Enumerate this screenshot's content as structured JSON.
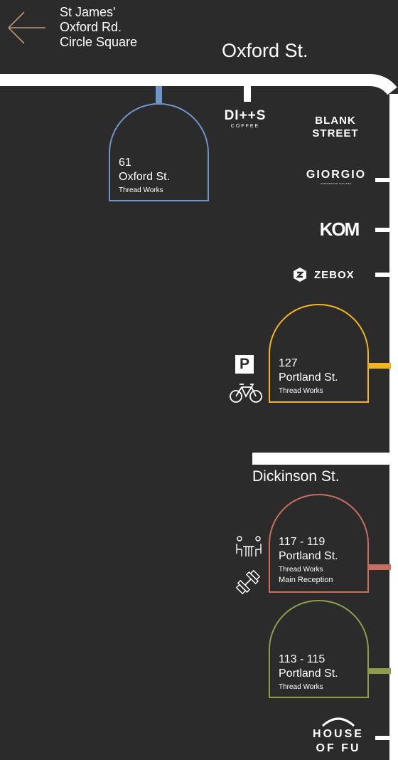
{
  "nav": {
    "back_icon": "arrow-left-icon",
    "destinations": [
      "St James'",
      "Oxford Rd.",
      "Circle Square"
    ]
  },
  "streets": {
    "oxford": "Oxford St.",
    "dickinson": "Dickinson St."
  },
  "buildings": [
    {
      "number": "61",
      "street": "Oxford St.",
      "name": "Thread Works",
      "extra": "",
      "color": "#6f95c8"
    },
    {
      "number": "127",
      "street": "Portland St.",
      "name": "Thread Works",
      "extra": "",
      "color": "#f0b51f"
    },
    {
      "number": "117 - 119",
      "street": "Portland St.",
      "name": "Thread Works",
      "extra": "Main Reception",
      "color": "#c76f5c"
    },
    {
      "number": "113 - 115",
      "street": "Portland St.",
      "name": "Thread Works",
      "extra": "",
      "color": "#8f9c4a"
    }
  ],
  "tenants": {
    "ditto": {
      "main": "DI++S",
      "sub": "COFFEE"
    },
    "blank_street": {
      "line1": "BLANK",
      "line2": "STREET"
    },
    "giorgio": {
      "main": "GIORGIO",
      "sub": "RISTORANTE ITALIANO"
    },
    "kom": "KOM",
    "zebox": "ZEBOX",
    "house_of_fu": {
      "line1": "HOUSE",
      "line2": "OF FU"
    }
  },
  "amenities": {
    "parking_letter": "P",
    "icons": [
      "parking-icon",
      "bicycle-icon",
      "meeting-room-icon",
      "gym-icon"
    ]
  }
}
